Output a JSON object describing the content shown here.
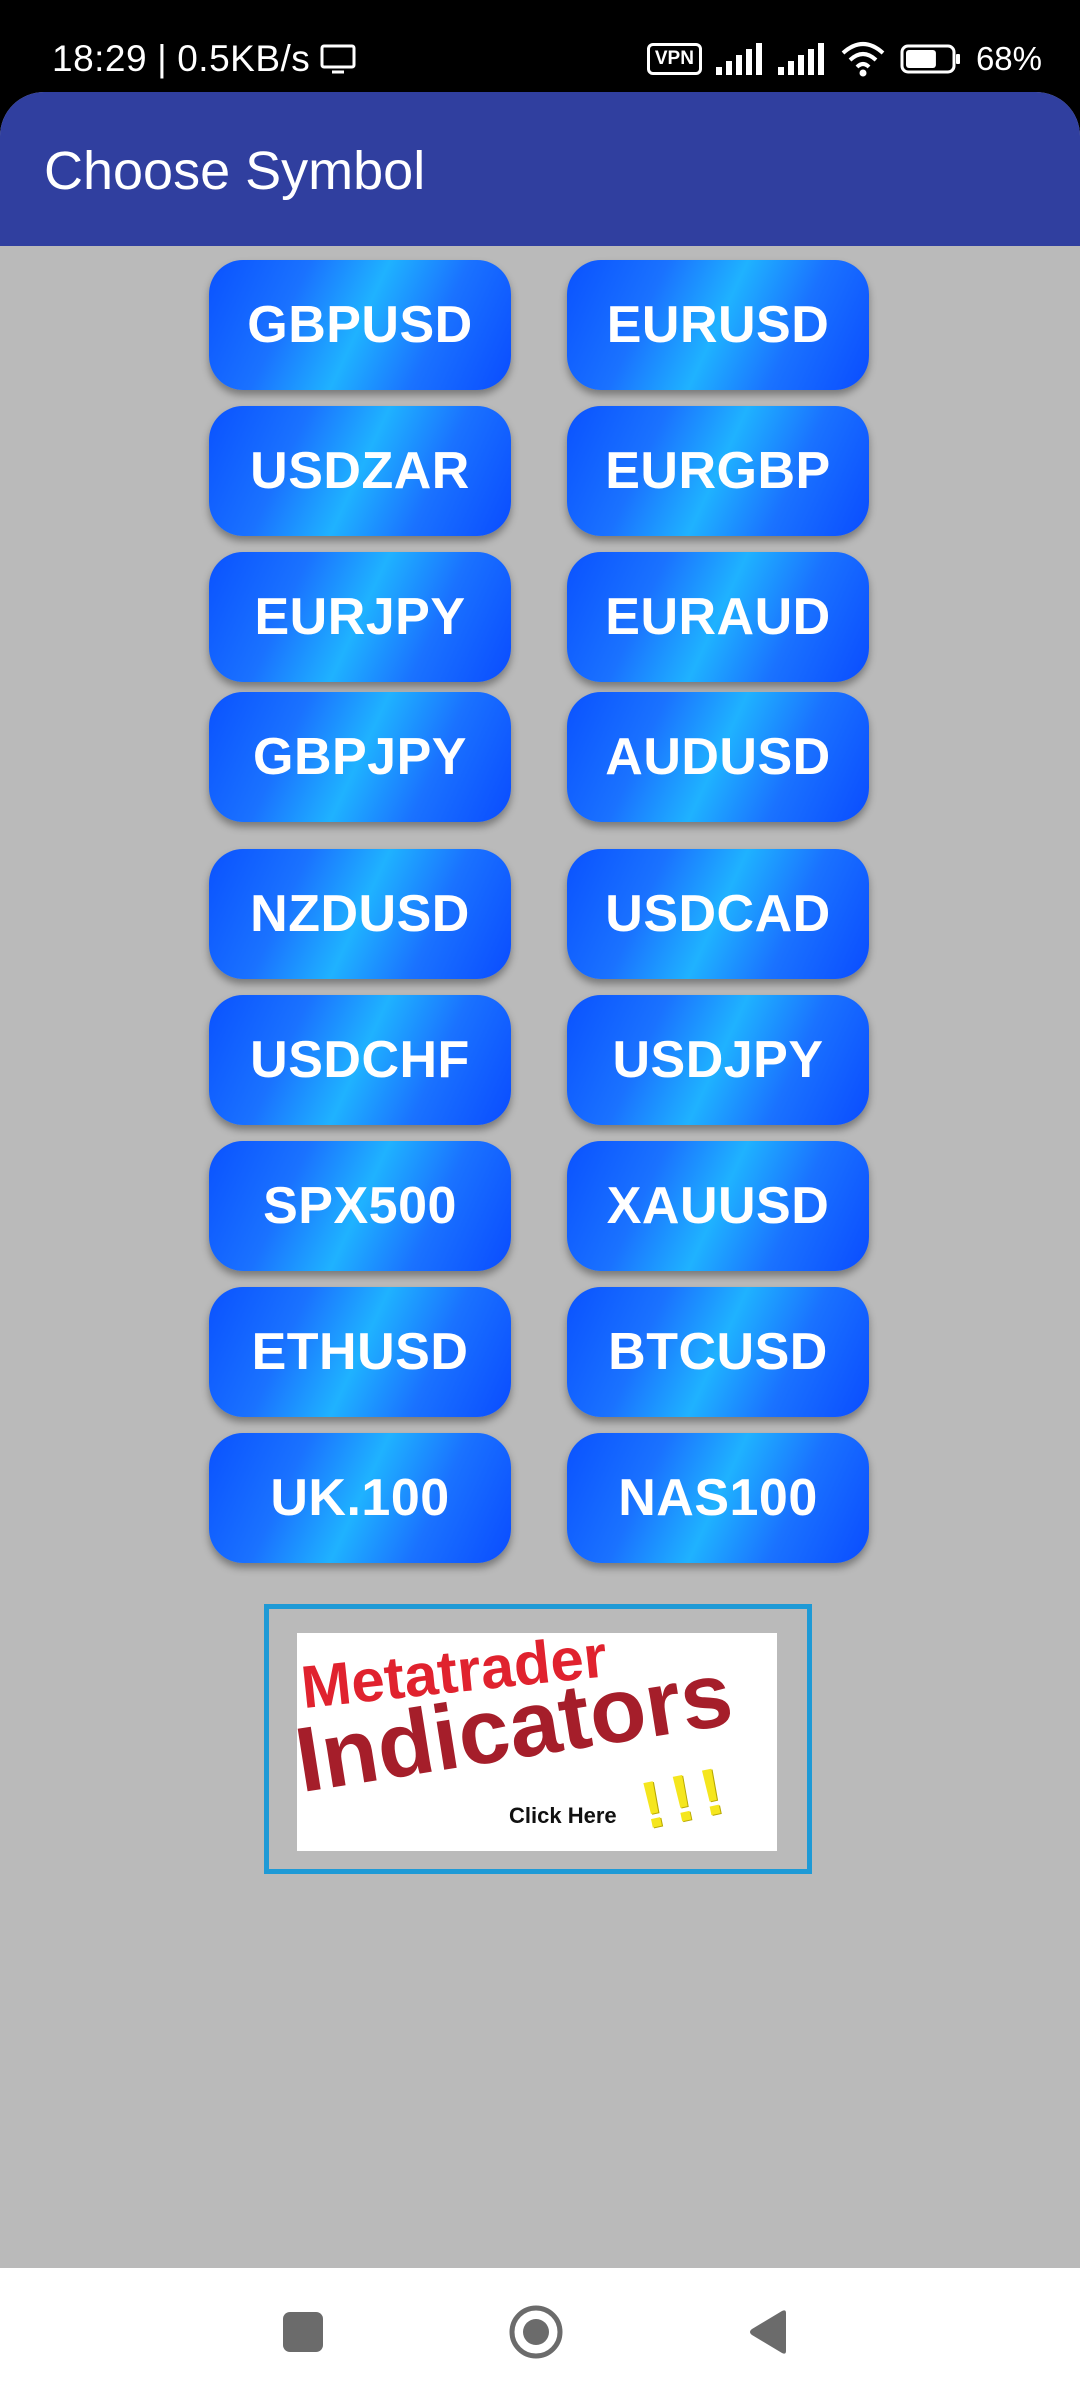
{
  "status_bar": {
    "time": "18:29",
    "separator": "|",
    "net_speed": "0.5KB/s",
    "vpn_label": "VPN",
    "battery_percent": "68%",
    "battery_level": 0.68,
    "icons": [
      "screen-cast-icon",
      "vpn-icon",
      "cell-signal-icon",
      "cell-signal-icon",
      "wifi-icon",
      "battery-icon"
    ]
  },
  "app_bar": {
    "title": "Choose Symbol"
  },
  "symbols": [
    "GBPUSD",
    "EURUSD",
    "USDZAR",
    "EURGBP",
    "EURJPY",
    "EURAUD",
    "GBPJPY",
    "AUDUSD",
    "NZDUSD",
    "USDCAD",
    "USDCHF",
    "USDJPY",
    "SPX500",
    "XAUUSD",
    "ETHUSD",
    "BTCUSD",
    "UK.100",
    "NAS100"
  ],
  "banner": {
    "line1": "Metatrader",
    "line2": "Indicators",
    "cta": "Click Here",
    "exclaim": "!!!"
  },
  "nav_bar": {
    "icons": [
      "recent-apps-icon",
      "home-icon",
      "back-icon"
    ]
  },
  "colors": {
    "app_bar": "#303f9f",
    "screen_background": "#bababa",
    "button_blue": "#1a72ff",
    "banner_border": "#1e9ad6"
  }
}
